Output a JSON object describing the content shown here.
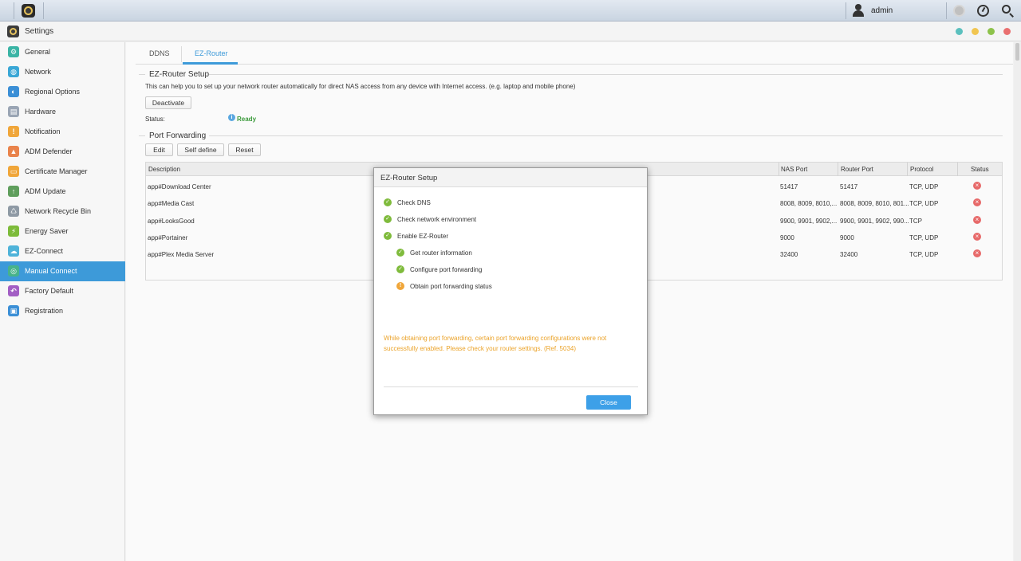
{
  "topbar": {
    "user_name": "admin",
    "icons": [
      "home-icon",
      "user-icon",
      "notification-icon",
      "dashboard-icon",
      "search-icon"
    ]
  },
  "window": {
    "title": "Settings",
    "controls_colors": [
      "#5bc0be",
      "#f1c550",
      "#8dc24a",
      "#e96f6f"
    ]
  },
  "sidebar": {
    "items": [
      {
        "label": "General",
        "icon": "general-icon",
        "color": "#3ab4a5"
      },
      {
        "label": "Network",
        "icon": "network-icon",
        "color": "#3aa7d6"
      },
      {
        "label": "Regional Options",
        "icon": "regional-options-icon",
        "color": "#3b8fd6"
      },
      {
        "label": "Hardware",
        "icon": "hardware-icon",
        "color": "#9aa5b4"
      },
      {
        "label": "Notification",
        "icon": "notification-icon",
        "color": "#f0a63a"
      },
      {
        "label": "ADM Defender",
        "icon": "adm-defender-icon",
        "color": "#e9834b"
      },
      {
        "label": "Certificate Manager",
        "icon": "certificate-manager-icon",
        "color": "#f0a63a"
      },
      {
        "label": "ADM Update",
        "icon": "adm-update-icon",
        "color": "#5f9e5c"
      },
      {
        "label": "Network Recycle Bin",
        "icon": "recycle-bin-icon",
        "color": "#8f9aa5"
      },
      {
        "label": "Energy Saver",
        "icon": "energy-saver-icon",
        "color": "#7dbb3a"
      },
      {
        "label": "EZ-Connect",
        "icon": "ez-connect-icon",
        "color": "#4fb3d9"
      },
      {
        "label": "Manual Connect",
        "icon": "manual-connect-icon",
        "color": "#47b38a"
      },
      {
        "label": "Factory Default",
        "icon": "factory-default-icon",
        "color": "#a25ec4"
      },
      {
        "label": "Registration",
        "icon": "registration-icon",
        "color": "#3b8fd6"
      }
    ],
    "active_index": 11
  },
  "tabs": [
    {
      "label": "DDNS"
    },
    {
      "label": "EZ-Router"
    }
  ],
  "ez_router_setup": {
    "title": "EZ-Router Setup",
    "description": "This can help you to set up your network router automatically for direct NAS access from any device with Internet access. (e.g. laptop and mobile phone)",
    "deactivate_label": "Deactivate",
    "status_label": "Status:",
    "status_value": "Ready",
    "status_color": "#3a9a3a"
  },
  "port_forwarding": {
    "title": "Port Forwarding",
    "buttons": {
      "edit": "Edit",
      "self_define": "Self define",
      "reset": "Reset"
    },
    "columns": [
      "Description",
      "NAS Port",
      "Router Port",
      "Protocol",
      "Status"
    ],
    "rows": [
      {
        "description": "app#Download Center",
        "nas_port": "51417",
        "router_port": "51417",
        "protocol": "TCP, UDP",
        "status": "error"
      },
      {
        "description": "app#Media Cast",
        "nas_port": "8008, 8009, 8010,...",
        "router_port": "8008, 8009, 8010, 801...",
        "protocol": "TCP, UDP",
        "status": "error"
      },
      {
        "description": "app#LooksGood",
        "nas_port": "9900, 9901, 9902,...",
        "router_port": "9900, 9901, 9902, 990...",
        "protocol": "TCP",
        "status": "error"
      },
      {
        "description": "app#Portainer",
        "nas_port": "9000",
        "router_port": "9000",
        "protocol": "TCP, UDP",
        "status": "error"
      },
      {
        "description": "app#Plex Media Server",
        "nas_port": "32400",
        "router_port": "32400",
        "protocol": "TCP, UDP",
        "status": "error"
      }
    ]
  },
  "dialog": {
    "title": "EZ-Router Setup",
    "steps": [
      {
        "label": "Check DNS",
        "state": "done"
      },
      {
        "label": "Check network environment",
        "state": "done"
      },
      {
        "label": "Enable EZ-Router",
        "state": "done"
      },
      {
        "label": "Get router information",
        "state": "done"
      },
      {
        "label": "Configure port forwarding",
        "state": "done"
      },
      {
        "label": "Obtain port forwarding status",
        "state": "warning"
      }
    ],
    "warning": "While obtaining port forwarding, certain port forwarding configurations were not successfully enabled. Please check your router settings. (Ref. 5034)",
    "warning_color": "#eba32a",
    "close_label": "Close",
    "accent": "#3da0e8"
  }
}
